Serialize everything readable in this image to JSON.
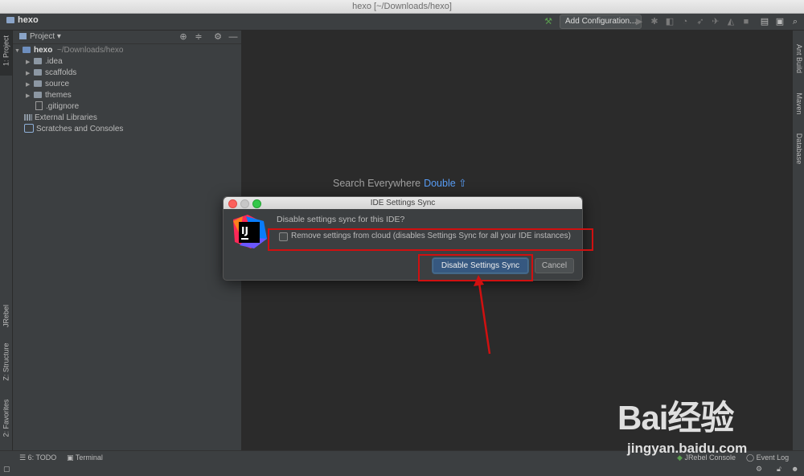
{
  "window": {
    "title": "hexo [~/Downloads/hexo]"
  },
  "toolbar": {
    "project_name": "hexo",
    "add_configuration": "Add Configuration..."
  },
  "left_strip": {
    "project_tab": "1: Project",
    "jrebel_tab": "JRebel",
    "structure_tab": "Z: Structure",
    "favorites_tab": "2: Favorites"
  },
  "right_strip": {
    "ant_tab": "Ant Build",
    "maven_tab": "Maven",
    "database_tab": "Database"
  },
  "project_panel": {
    "title": "Project",
    "root": {
      "name": "hexo",
      "path": "~/Downloads/hexo"
    },
    "items": [
      {
        "label": ".idea",
        "type": "folder"
      },
      {
        "label": "scaffolds",
        "type": "folder"
      },
      {
        "label": "source",
        "type": "folder"
      },
      {
        "label": "themes",
        "type": "folder"
      },
      {
        "label": ".gitignore",
        "type": "file"
      }
    ],
    "external_libraries": "External Libraries",
    "scratches": "Scratches and Consoles"
  },
  "editor": {
    "search_hint": "Search Everywhere",
    "search_key": "Double ⇧"
  },
  "dialog": {
    "title": "IDE Settings Sync",
    "question": "Disable settings sync for this IDE?",
    "checkbox_label": "Remove settings from cloud (disables Settings Sync for all your IDE instances)",
    "checkbox_checked": false,
    "primary_button": "Disable Settings Sync",
    "cancel_button": "Cancel",
    "logo_text": "IJ"
  },
  "statusbar": {
    "todo": "6: TODO",
    "terminal": "Terminal",
    "jrebel_console": "JRebel Console",
    "event_log": "Event Log"
  },
  "watermark": {
    "logo": "Bai经验",
    "url": "jingyan.baidu.com"
  },
  "colors": {
    "accent": "#589df6",
    "primary_button": "#365880",
    "annotation": "#d01010"
  }
}
